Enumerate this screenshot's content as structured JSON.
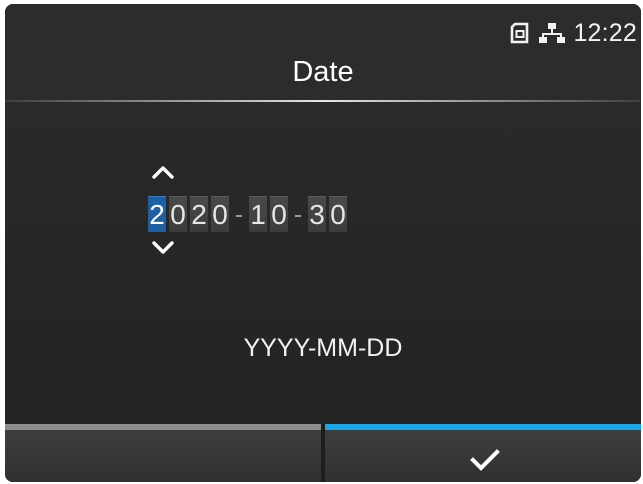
{
  "status": {
    "time": "12:22",
    "icons": [
      "sd-card-icon",
      "network-icon"
    ]
  },
  "screen": {
    "title": "Date"
  },
  "date_input": {
    "digits": [
      "2",
      "0",
      "2",
      "0",
      "1",
      "0",
      "3",
      "0"
    ],
    "separator": "-",
    "selected_index": 0,
    "format_hint": "YYYY-MM-DD"
  },
  "footer": {
    "confirm_icon": "check-icon"
  },
  "colors": {
    "background": "#282828",
    "selected_digit": "#1f5fa3",
    "confirm_accent": "#17a7e6",
    "cancel_accent": "#8e8e8e"
  }
}
